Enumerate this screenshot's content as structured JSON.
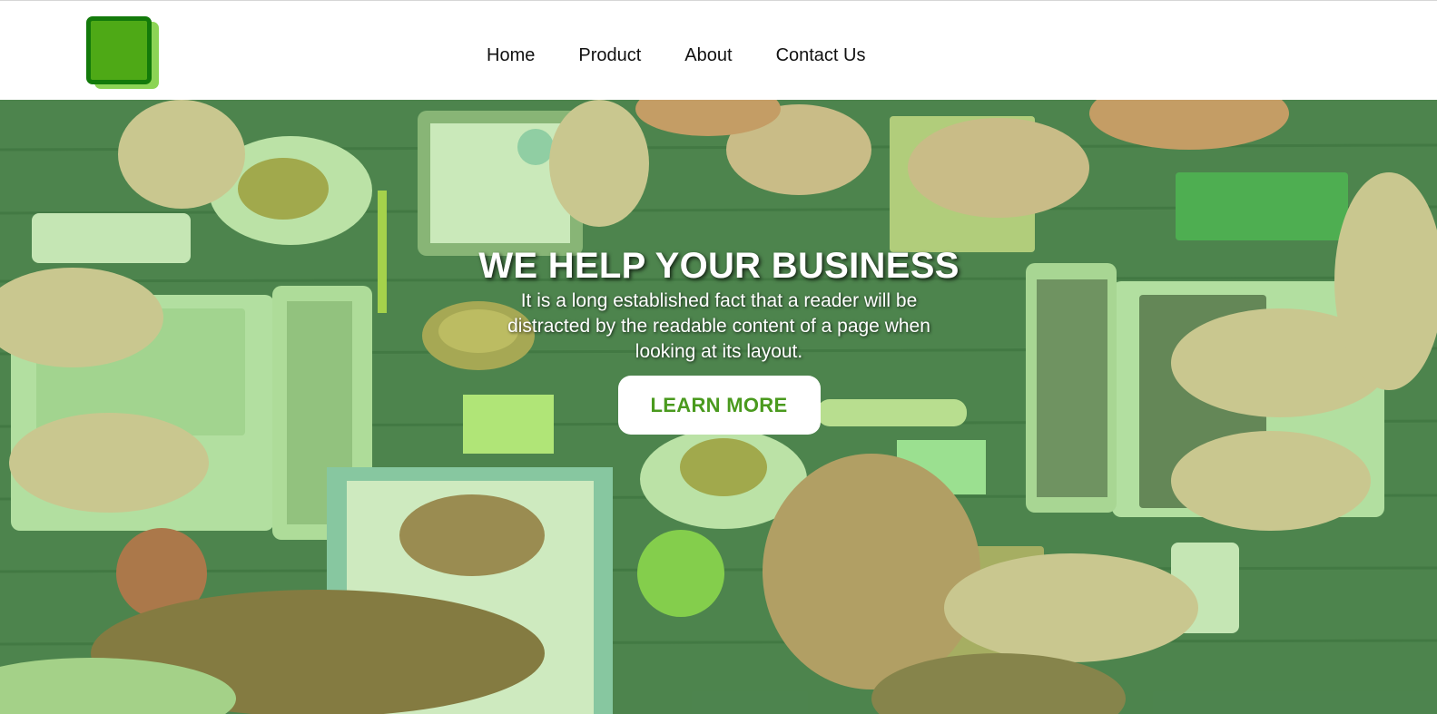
{
  "nav": {
    "links": [
      "Home",
      "Product",
      "About",
      "Contact Us"
    ]
  },
  "hero": {
    "title": "WE HELP YOUR BUSINESS",
    "text": "It is a long established fact that a reader will be distracted by the readable content of a page when looking at its layout.",
    "button_label": "LEARN MORE"
  },
  "colors": {
    "logo_dark": "#137a0a",
    "logo_mid": "#4ea916",
    "logo_light": "#8cd455",
    "hero_tint": "#78c850",
    "button_text": "#4a9a1e"
  },
  "icons": {
    "logo": "logo-icon"
  }
}
